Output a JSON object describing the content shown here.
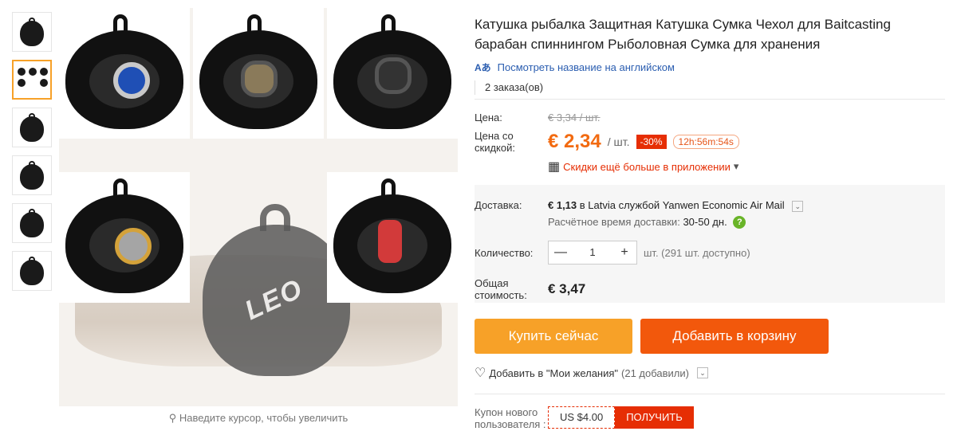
{
  "gallery": {
    "zoom_hint": "Наведите курсор, чтобы увеличить",
    "big_logo": "LEO"
  },
  "product": {
    "title": "Катушка рыбалка Защитная Катушка Сумка Чехол для Baitcasting барабан спиннингом Рыболовная Сумка для хранения",
    "translate_icon": "Aあ",
    "translate_link": "Посмотреть название на английском",
    "orders": "2 заказа(ов)"
  },
  "price": {
    "label": "Цена:",
    "old_value": "€ 3,34 / шт.",
    "discount_label": "Цена со скидкой:",
    "new_value": "€ 2,34",
    "unit": "/ шт.",
    "discount": "-30%",
    "timer": "12h:56m:54s",
    "app_deal": "Скидки ещё больше в приложении",
    "app_deal_arrow": "▾"
  },
  "shipping": {
    "label": "Доставка:",
    "amount": "€ 1,13",
    "text": "в Latvia службой Yanwen Economic Air Mail",
    "eta_label": "Расчётное время доставки:",
    "eta_value": "30-50 дн.",
    "help_mark": "?"
  },
  "quantity": {
    "label": "Количество:",
    "value": "1",
    "minus": "—",
    "plus": "+",
    "available": "шт. (291 шт. доступно)"
  },
  "total": {
    "label": "Общая стоимость:",
    "value": "€ 3,47"
  },
  "actions": {
    "buy_now": "Купить сейчас",
    "add_to_cart": "Добавить в корзину",
    "wishlist": "Добавить в \"Мои желания\"",
    "wishlist_count": "(21 добавили)"
  },
  "coupon": {
    "label": "Купон нового пользователя :",
    "value": "US $4.00",
    "get": "ПОЛУЧИТЬ"
  },
  "icons": {
    "heart": "♡",
    "search": "⚲",
    "chevron": "⌄",
    "qr": "▦"
  },
  "colors": {
    "accent_orange": "#f7a128",
    "cart_orange": "#f2580c",
    "price": "#f26a10",
    "sale_red": "#e62e04",
    "link_blue": "#2a5db0"
  }
}
